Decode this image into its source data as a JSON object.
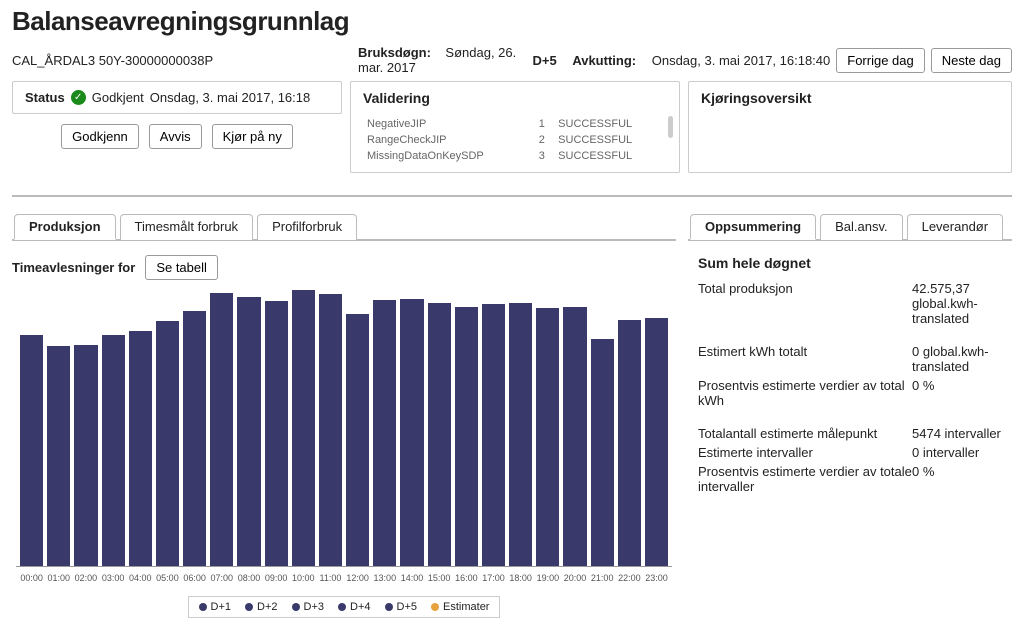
{
  "page_title": "Balanseavregningsgrunnlag",
  "entity_id": "CAL_ÅRDAL3 50Y-30000000038P",
  "bruksdogn_label": "Bruksdøgn:",
  "bruksdogn_value": "Søndag, 26. mar. 2017",
  "dplus": "D+5",
  "avkutting_label": "Avkutting:",
  "avkutting_value": "Onsdag, 3. mai 2017, 16:18:40",
  "btn_prev": "Forrige dag",
  "btn_next": "Neste dag",
  "status": {
    "label": "Status",
    "state": "Godkjent",
    "timestamp": "Onsdag, 3. mai 2017, 16:18"
  },
  "actions": {
    "approve": "Godkjenn",
    "reject": "Avvis",
    "rerun": "Kjør på ny"
  },
  "validering": {
    "title": "Validering",
    "rows": [
      {
        "name": "NegativeJIP",
        "idx": "1",
        "status": "SUCCESSFUL"
      },
      {
        "name": "RangeCheckJIP",
        "idx": "2",
        "status": "SUCCESSFUL"
      },
      {
        "name": "MissingDataOnKeySDP",
        "idx": "3",
        "status": "SUCCESSFUL"
      }
    ]
  },
  "kjoring_title": "Kjøringsoversikt",
  "left_tabs": [
    "Produksjon",
    "Timesmålt forbruk",
    "Profilforbruk"
  ],
  "right_tabs": [
    "Oppsummering",
    "Bal.ansv.",
    "Leverandør"
  ],
  "chart_header_label": "Timeavlesninger for",
  "btn_table": "Se tabell",
  "legend": [
    "D+1",
    "D+2",
    "D+3",
    "D+4",
    "D+5",
    "Estimater"
  ],
  "summary": {
    "title": "Sum hele døgnet",
    "rows1": [
      {
        "l": "Total produksjon",
        "v": "42.575,37 global.kwh-translated"
      }
    ],
    "rows2": [
      {
        "l": "Estimert kWh totalt",
        "v": "0 global.kwh-translated"
      },
      {
        "l": "Prosentvis estimerte verdier av total kWh",
        "v": "0 %"
      }
    ],
    "rows3": [
      {
        "l": "Totalantall estimerte målepunkt",
        "v": "5474 intervaller"
      },
      {
        "l": "Estimerte intervaller",
        "v": "0 intervaller"
      },
      {
        "l": "Prosentvis estimerte verdier av totale intervaller",
        "v": "0 %"
      }
    ]
  },
  "chart_data": {
    "type": "bar",
    "title": "Timeavlesninger for",
    "xlabel": "",
    "ylabel": "",
    "categories": [
      "00:00",
      "01:00",
      "02:00",
      "03:00",
      "04:00",
      "05:00",
      "06:00",
      "07:00",
      "08:00",
      "09:00",
      "10:00",
      "11:00",
      "12:00",
      "13:00",
      "14:00",
      "15:00",
      "16:00",
      "17:00",
      "18:00",
      "19:00",
      "20:00",
      "21:00",
      "22:00",
      "23:00"
    ],
    "values": [
      1650,
      1570,
      1580,
      1650,
      1680,
      1750,
      1820,
      1950,
      1920,
      1890,
      1970,
      1940,
      1800,
      1900,
      1910,
      1880,
      1850,
      1870,
      1880,
      1840,
      1850,
      1620,
      1760,
      1770
    ],
    "ylim": [
      0,
      2000
    ]
  }
}
